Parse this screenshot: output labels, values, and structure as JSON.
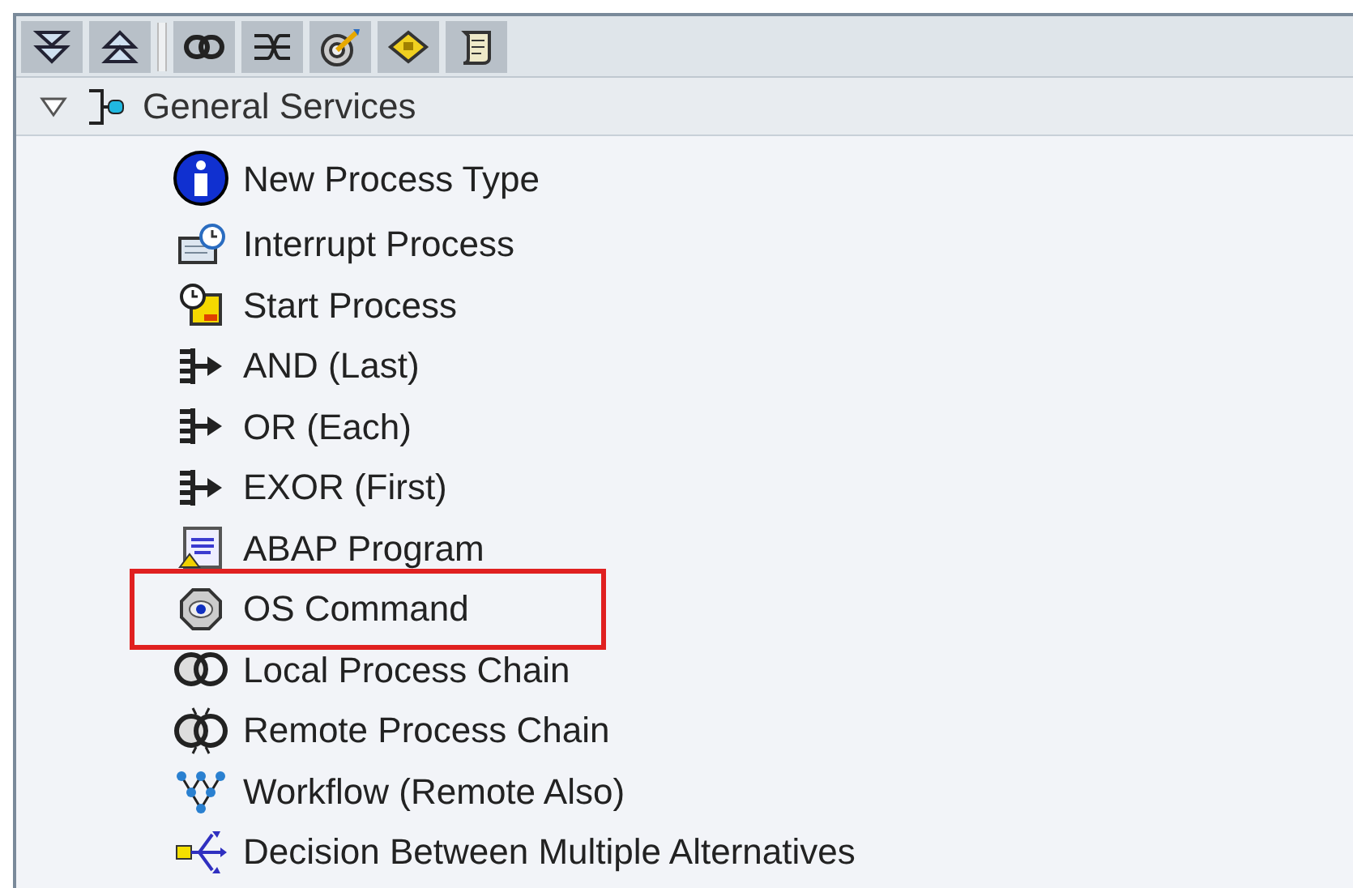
{
  "tree": {
    "label": "General Services",
    "expanded": true,
    "children": [
      {
        "kind": "info",
        "label": "New Process Type",
        "highlighted": false
      },
      {
        "kind": "interrupt",
        "label": "Interrupt Process",
        "highlighted": false
      },
      {
        "kind": "start",
        "label": "Start Process",
        "highlighted": false
      },
      {
        "kind": "branch",
        "label": "AND (Last)",
        "highlighted": false
      },
      {
        "kind": "branch",
        "label": "OR (Each)",
        "highlighted": false
      },
      {
        "kind": "branch",
        "label": "EXOR (First)",
        "highlighted": false
      },
      {
        "kind": "abap",
        "label": "ABAP Program",
        "highlighted": false
      },
      {
        "kind": "os",
        "label": "OS Command",
        "highlighted": true
      },
      {
        "kind": "local-chain",
        "label": "Local Process Chain",
        "highlighted": false
      },
      {
        "kind": "remote-chain",
        "label": "Remote Process Chain",
        "highlighted": false
      },
      {
        "kind": "workflow",
        "label": "Workflow (Remote Also)",
        "highlighted": false
      },
      {
        "kind": "decision",
        "label": "Decision Between Multiple Alternatives",
        "highlighted": false
      }
    ]
  }
}
